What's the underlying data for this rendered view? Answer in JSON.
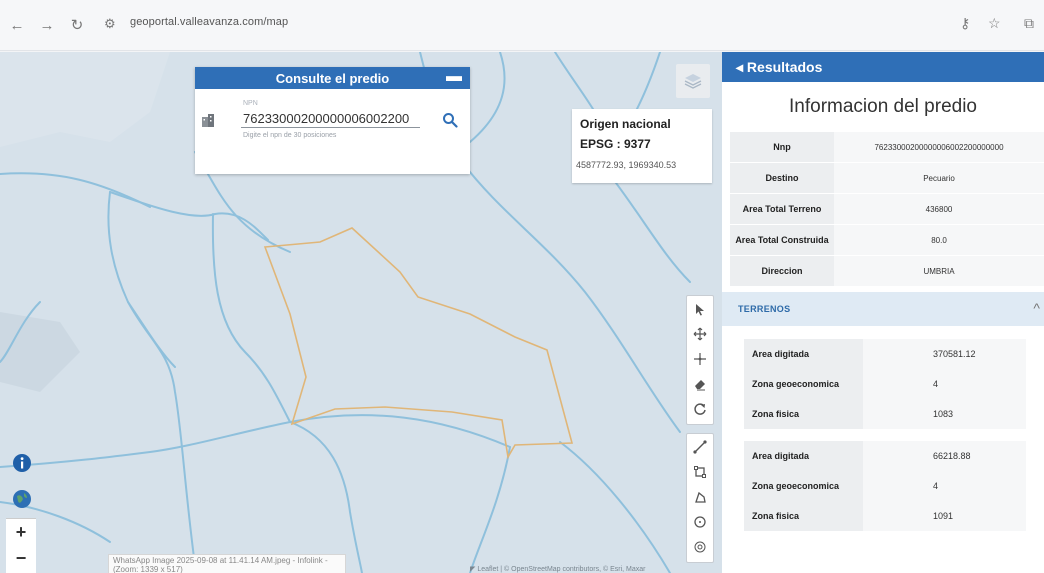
{
  "browser": {
    "url": "geoportal.valleavanza.com/map",
    "back_icon": "back-arrow-icon",
    "forward_icon": "forward-arrow-icon",
    "reload_icon": "reload-icon"
  },
  "search": {
    "title": "Consulte el predio",
    "field_label": "NPN",
    "value": "76233000200000006002200",
    "hint": "Digite el npn de 30 posiciones"
  },
  "origin": {
    "title": "Origen nacional",
    "epsg": "EPSG : 9377",
    "coords": "4587772.93, 1969340.53"
  },
  "results": {
    "header": "◂ Resultados",
    "title": "Informacion del predio",
    "rows": [
      {
        "key": "Nnp",
        "value": "76233000200000006002200000000"
      },
      {
        "key": "Destino",
        "value": "Pecuario"
      },
      {
        "key": "Area Total Terreno",
        "value": "436800"
      },
      {
        "key": "Area Total Construida",
        "value": "80.0"
      },
      {
        "key": "Direccion",
        "value": "UMBRIA"
      }
    ],
    "terrenos_label": "TERRENOS",
    "terrenos": [
      [
        {
          "key": "Area digitada",
          "value": "370581.12"
        },
        {
          "key": "Zona geoeconomica",
          "value": "4"
        },
        {
          "key": "Zona fisica",
          "value": "1083"
        }
      ],
      [
        {
          "key": "Area digitada",
          "value": "66218.88"
        },
        {
          "key": "Zona geoeconomica",
          "value": "4"
        },
        {
          "key": "Zona fisica",
          "value": "1091"
        }
      ]
    ]
  },
  "map": {
    "tooltip": "WhatsApp Image 2025-09-08 at 11.41.14 AM.jpeg - Infolink - (Zoom: 1339 x 517)",
    "attribution": "◤ Leaflet | © OpenStreetMap contributors, © Esri, Maxar"
  },
  "colors": {
    "accent": "#2f6fb7",
    "river": "#8fc0dc",
    "parcel_outline": "#e0b678",
    "map_bg": "#d6e1ea"
  }
}
